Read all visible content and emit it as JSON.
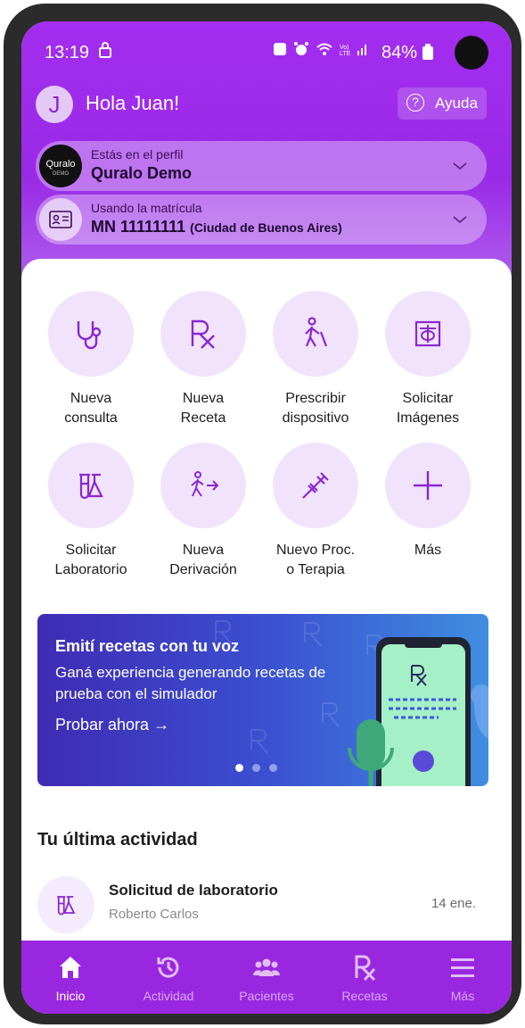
{
  "status_bar": {
    "time": "13:19",
    "battery": "84%"
  },
  "header": {
    "avatar_initial": "J",
    "greeting": "Hola Juan!",
    "help_label": "Ayuda"
  },
  "profile_selector": {
    "caption": "Estás en el perfil",
    "value": "Quralo Demo",
    "logo_text": "Quralo",
    "logo_subtext": "DEMO"
  },
  "license_selector": {
    "caption": "Usando la matrícula",
    "value": "MN 11111111",
    "detail": "(Ciudad de Buenos Aires)"
  },
  "actions": [
    {
      "label": "Nueva\nconsulta",
      "icon": "stethoscope-icon"
    },
    {
      "label": "Nueva\nReceta",
      "icon": "rx-icon"
    },
    {
      "label": "Prescribir\ndispositivo",
      "icon": "walking-cane-icon"
    },
    {
      "label": "Solicitar\nImágenes",
      "icon": "imaging-icon"
    },
    {
      "label": "Solicitar\nLaboratorio",
      "icon": "lab-flask-icon"
    },
    {
      "label": "Nueva\nDerivación",
      "icon": "referral-icon"
    },
    {
      "label": "Nuevo Proc.\no Terapia",
      "icon": "syringe-icon"
    },
    {
      "label": "Más",
      "icon": "plus-icon"
    }
  ],
  "banner": {
    "title": "Emití recetas con tu voz",
    "description": "Ganá experiencia generando recetas de prueba con el simulador",
    "cta": "Probar ahora →",
    "page_count": 3,
    "active_page": 1
  },
  "activity": {
    "section_title": "Tu última actividad",
    "items": [
      {
        "title": "Solicitud de laboratorio",
        "subtitle": "Roberto Carlos",
        "date": "14 ene.",
        "icon": "lab-flask-icon"
      }
    ]
  },
  "bottom_nav": [
    {
      "label": "Inicio",
      "icon": "home-icon",
      "active": true
    },
    {
      "label": "Actividad",
      "icon": "history-icon",
      "active": false
    },
    {
      "label": "Pacientes",
      "icon": "patients-icon",
      "active": false
    },
    {
      "label": "Recetas",
      "icon": "rx-icon",
      "active": false
    },
    {
      "label": "Más",
      "icon": "menu-icon",
      "active": false
    }
  ],
  "colors": {
    "brand_purple": "#9a27e0",
    "action_circle": "#f0e3fb",
    "banner_start": "#3f2bb3",
    "banner_end": "#3f8ee0"
  }
}
